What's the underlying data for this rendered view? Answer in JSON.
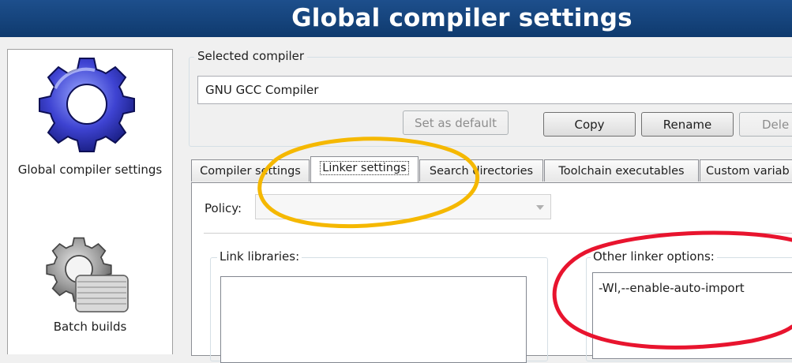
{
  "window": {
    "title": "Global compiler settings"
  },
  "sidebar": {
    "items": [
      {
        "label": "Global compiler settings",
        "icon": "gear-icon"
      },
      {
        "label": "Batch builds",
        "icon": "batch-builds-icon"
      }
    ]
  },
  "compiler": {
    "group_label": "Selected compiler",
    "selected": "GNU GCC Compiler",
    "buttons": {
      "set_default": "Set as default",
      "copy": "Copy",
      "rename": "Rename",
      "delete": "Dele"
    }
  },
  "tabs": [
    {
      "label": "Compiler settings"
    },
    {
      "label": "Linker settings"
    },
    {
      "label": "Search directories"
    },
    {
      "label": "Toolchain executables"
    },
    {
      "label": "Custom variab"
    }
  ],
  "linker": {
    "policy_label": "Policy:",
    "policy_value": "",
    "link_libraries_label": "Link libraries:",
    "other_options_label": "Other linker options:",
    "other_options_value": "-Wl,--enable-auto-import"
  },
  "annotation_colors": {
    "tab_highlight": "#f5b800",
    "option_highlight": "#e8142e"
  }
}
